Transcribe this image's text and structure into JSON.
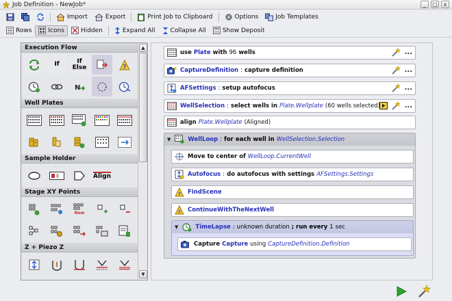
{
  "window": {
    "title": "Job Definition - NewJob*",
    "minimize": "_",
    "maximize": "□",
    "close": "x"
  },
  "toolbar1": {
    "import_label": "Import",
    "export_label": "Export",
    "print_label": "Print Job to Clipboard",
    "options_label": "Options",
    "templates_label": "Job Templates"
  },
  "toolbar2": {
    "rows_label": "Rows",
    "icons_label": "Icons",
    "hidden_label": "Hidden",
    "expand_label": "Expand All",
    "collapse_label": "Collapse All",
    "deposit_label": "Show Deposit"
  },
  "palette": {
    "sections": {
      "execution_flow": "Execution Flow",
      "well_plates": "Well Plates",
      "sample_holder": "Sample Holder",
      "stage_xy": "Stage XY Points",
      "z_piezo": "Z + Piezo Z"
    },
    "tiles": {
      "if": "If",
      "if_else_1": "If",
      "if_else_2": "Else",
      "align": "Align",
      "new": "New"
    }
  },
  "job": {
    "row1": {
      "kw1": "use",
      "name": "Plate",
      "kw2": "with",
      "count": "96",
      "kw3": "wells"
    },
    "row2": {
      "name": "CaptureDefinition",
      "sep": ":",
      "desc": "capture definition"
    },
    "row3": {
      "name": "AFSettings",
      "sep": ":",
      "desc": "setup autofocus"
    },
    "row4": {
      "name": "WellSelection",
      "sep": ":",
      "desc": "select wells in",
      "ref": "Plate.Wellplate",
      "note": "(60 wells selected)"
    },
    "row5": {
      "kw": "align",
      "ref": "Plate.Wellplate",
      "note": "(Aligned)"
    },
    "loop": {
      "name": "WellLoop",
      "sep": ":",
      "desc": "for each well in",
      "ref": "WellSelection.Selection"
    },
    "move": {
      "desc": "Move to center of",
      "ref": "WellLoop.CurrentWell"
    },
    "af": {
      "name": "Autofocus",
      "sep": ":",
      "desc": "do autofocus with settings",
      "ref": "AFSettings.Settings"
    },
    "find": {
      "name": "FindScene"
    },
    "cont": {
      "name": "ContinueWithTheNextWell"
    },
    "timelapse": {
      "name": "TimeLapse",
      "sep": ":",
      "desc": "unknown duration",
      "semi": ";",
      "kw": "run every",
      "val": "1",
      "unit": "sec"
    },
    "capture": {
      "kw": "Capture",
      "name": "Capture",
      "pl": "using",
      "ref": "CaptureDefinition.Definition"
    },
    "more": "..."
  },
  "colors": {
    "accent_blue": "#2530b8",
    "run_green": "#2aa52a"
  }
}
